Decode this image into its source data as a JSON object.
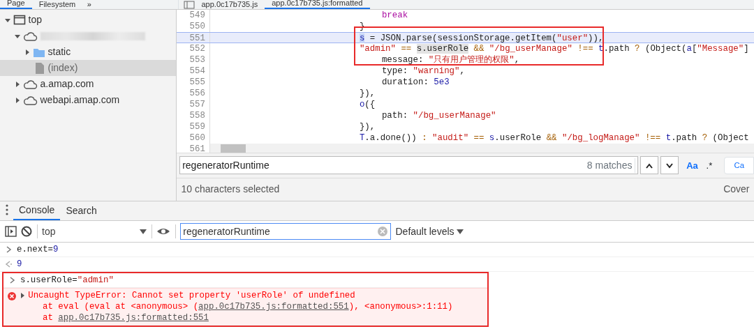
{
  "left_tabs": [
    {
      "label": "Page",
      "selected": true
    },
    {
      "label": "Filesystem",
      "selected": false
    }
  ],
  "left_more": "»",
  "tree": [
    {
      "kind": "frame",
      "label": "top",
      "expanded": true,
      "selected": false,
      "children": [
        {
          "kind": "domain",
          "redacted": true,
          "expanded": true,
          "selected": false,
          "children": [
            {
              "kind": "folder",
              "label": "static",
              "expanded": false,
              "selected": false
            },
            {
              "kind": "file",
              "label": "(index)",
              "selected": true
            }
          ]
        },
        {
          "kind": "domain",
          "label": "a.amap.com",
          "expanded": false,
          "selected": false
        },
        {
          "kind": "domain",
          "label": "webapi.amap.com",
          "expanded": false,
          "selected": false
        }
      ]
    }
  ],
  "editor_tabs": [
    {
      "label": "app.0c17b735.js",
      "selected": false
    },
    {
      "label": "app.0c17b735.js:formatted",
      "selected": true
    }
  ],
  "code_lines": [
    {
      "number": "549",
      "highlighted": false,
      "indented": true,
      "segments": [
        {
          "kind": "keyword",
          "text": "break"
        }
      ]
    },
    {
      "number": "550",
      "highlighted": false,
      "indented": false,
      "segments": [
        {
          "kind": "plain",
          "text": "}"
        }
      ]
    },
    {
      "number": "551",
      "highlighted": true,
      "indented": false,
      "segments": [
        {
          "kind": "match",
          "text": "s"
        },
        {
          "kind": "plain",
          "text": " = JSON.parse(sessionStorage.getItem("
        },
        {
          "kind": "string",
          "text": "\"user\""
        },
        {
          "kind": "plain",
          "text": ")),"
        }
      ]
    },
    {
      "number": "552",
      "highlighted": false,
      "indented": false,
      "segments": [
        {
          "kind": "string",
          "text": "\"admin\""
        },
        {
          "kind": "operator",
          "text": " == "
        },
        {
          "kind": "selection",
          "text": "s.userRole"
        },
        {
          "kind": "operator",
          "text": " && "
        },
        {
          "kind": "string",
          "text": "\"/bg_userManage\""
        },
        {
          "kind": "operator",
          "text": " !== "
        },
        {
          "kind": "variable",
          "text": "t"
        },
        {
          "kind": "plain",
          "text": ".path "
        },
        {
          "kind": "operator",
          "text": "?"
        },
        {
          "kind": "plain",
          "text": " (Object("
        },
        {
          "kind": "variable",
          "text": "a"
        },
        {
          "kind": "plain",
          "text": "["
        },
        {
          "kind": "string",
          "text": "\"Message\""
        },
        {
          "kind": "plain",
          "text": "]"
        }
      ]
    },
    {
      "number": "553",
      "highlighted": false,
      "indented": true,
      "segments": [
        {
          "kind": "plain",
          "text": "message: "
        },
        {
          "kind": "string",
          "text": "\"只有用户管理的权限\""
        },
        {
          "kind": "plain",
          "text": ","
        }
      ]
    },
    {
      "number": "554",
      "highlighted": false,
      "indented": true,
      "segments": [
        {
          "kind": "plain",
          "text": "type: "
        },
        {
          "kind": "string",
          "text": "\"warning\""
        },
        {
          "kind": "plain",
          "text": ","
        }
      ]
    },
    {
      "number": "555",
      "highlighted": false,
      "indented": true,
      "segments": [
        {
          "kind": "plain",
          "text": "duration: "
        },
        {
          "kind": "variable",
          "text": "5e3"
        }
      ]
    },
    {
      "number": "556",
      "highlighted": false,
      "indented": false,
      "segments": [
        {
          "kind": "plain",
          "text": "}),"
        }
      ]
    },
    {
      "number": "557",
      "highlighted": false,
      "indented": false,
      "segments": [
        {
          "kind": "variable",
          "text": "o"
        },
        {
          "kind": "plain",
          "text": "({"
        }
      ]
    },
    {
      "number": "558",
      "highlighted": false,
      "indented": true,
      "segments": [
        {
          "kind": "plain",
          "text": "path: "
        },
        {
          "kind": "string",
          "text": "\"/bg_userManage\""
        }
      ]
    },
    {
      "number": "559",
      "highlighted": false,
      "indented": false,
      "segments": [
        {
          "kind": "plain",
          "text": "}),"
        }
      ]
    },
    {
      "number": "560",
      "highlighted": false,
      "indented": false,
      "segments": [
        {
          "kind": "variable",
          "text": "T"
        },
        {
          "kind": "plain",
          "text": ".a.done()) "
        },
        {
          "kind": "operator",
          "text": ": "
        },
        {
          "kind": "string",
          "text": "\"audit\""
        },
        {
          "kind": "operator",
          "text": " == "
        },
        {
          "kind": "variable",
          "text": "s"
        },
        {
          "kind": "plain",
          "text": ".userRole "
        },
        {
          "kind": "operator",
          "text": "&& "
        },
        {
          "kind": "string",
          "text": "\"/bg_logManage\""
        },
        {
          "kind": "operator",
          "text": " !== "
        },
        {
          "kind": "variable",
          "text": "t"
        },
        {
          "kind": "plain",
          "text": ".path "
        },
        {
          "kind": "operator",
          "text": "?"
        },
        {
          "kind": "plain",
          "text": " (Object"
        }
      ]
    },
    {
      "number": "561",
      "highlighted": false
    }
  ],
  "find_bar": {
    "value": "regeneratorRuntime",
    "matches": "8 matches",
    "match_case": "Aa",
    "regex": ".*",
    "cancel": "Ca"
  },
  "status_bar": {
    "text": "10 characters selected",
    "coverage": "Cover"
  },
  "drawer_tabs": [
    {
      "label": "Console",
      "selected": true
    },
    {
      "label": "Search",
      "selected": false
    }
  ],
  "console_toolbar": {
    "context": "top",
    "filter": "regeneratorRuntime",
    "levels": "Default levels"
  },
  "console_messages": [
    {
      "kind": "input",
      "segments": [
        {
          "kind": "plain",
          "text": "e.next="
        },
        {
          "kind": "number",
          "text": "9"
        }
      ]
    },
    {
      "kind": "result",
      "segments": [
        {
          "kind": "number",
          "text": "9"
        }
      ]
    },
    {
      "kind": "input",
      "segments": [
        {
          "kind": "plain",
          "text": "s.userRole="
        },
        {
          "kind": "string",
          "text": "\"admin\""
        }
      ]
    },
    {
      "kind": "error",
      "expanded": false,
      "lines": [
        [
          {
            "kind": "plain",
            "text": "Uncaught TypeError: Cannot set property 'userRole' of undefined"
          }
        ],
        [
          {
            "kind": "plain",
            "text": "at eval (eval at <anonymous> ("
          },
          {
            "kind": "link",
            "text": "app.0c17b735.js:formatted:551"
          },
          {
            "kind": "plain",
            "text": "), <anonymous>:1:11)"
          }
        ],
        [
          {
            "kind": "plain",
            "text": "at "
          },
          {
            "kind": "link",
            "text": "app.0c17b735.js:formatted:551"
          }
        ]
      ]
    }
  ]
}
